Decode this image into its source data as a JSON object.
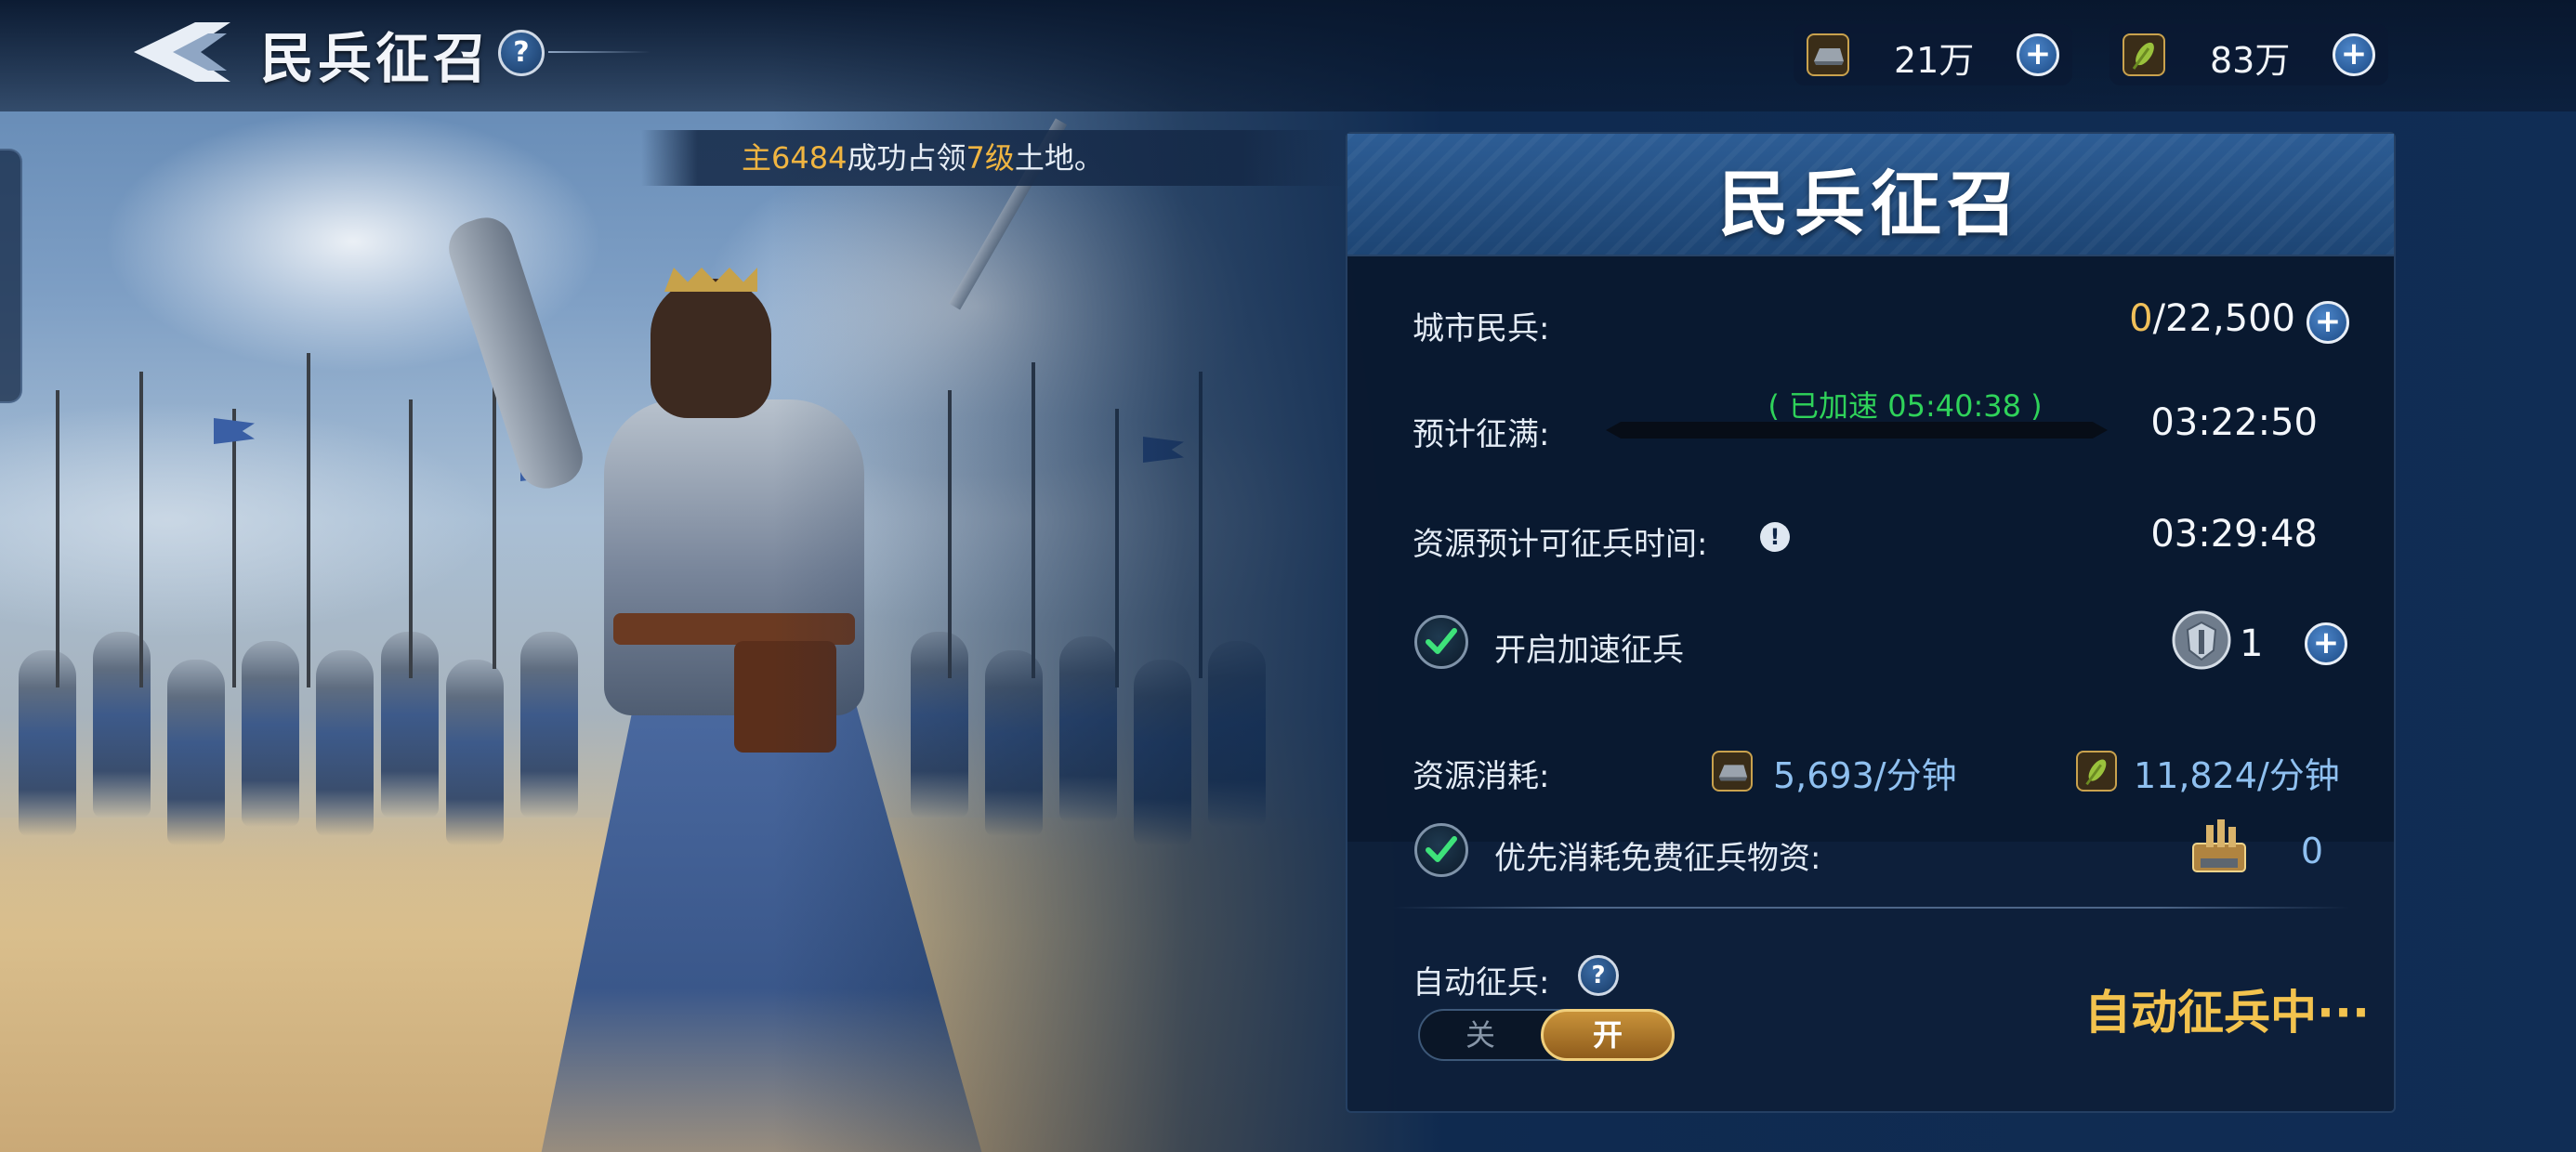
{
  "header": {
    "title": "民兵征召"
  },
  "resources": [
    {
      "icon": "iron-ingot-icon",
      "amount": "21万"
    },
    {
      "icon": "wheat-icon",
      "amount": "83万"
    }
  ],
  "ticker": {
    "prefix": "主",
    "player_id": "6484",
    "mid": "成功占领",
    "level": "7级",
    "suffix": "土地。"
  },
  "panel": {
    "title": "民兵征召",
    "city_militia": {
      "label": "城市民兵:",
      "current": "0",
      "max": "/22,500"
    },
    "eta": {
      "label": "预计征满:",
      "accelerated_note": "( 已加速 05:40:38 )",
      "time": "03:22:50"
    },
    "resource_time": {
      "label": "资源预计可征兵时间:",
      "time": "03:29:48"
    },
    "speed_up": {
      "label": "开启加速征兵",
      "checked": true,
      "item_icon": "helmet-shield-icon",
      "count": "1"
    },
    "consumption": {
      "label": "资源消耗:",
      "iron_rate": "5,693/分钟",
      "food_rate": "11,824/分钟"
    },
    "free_supplies": {
      "label": "优先消耗免费征兵物资:",
      "checked": true,
      "item_icon": "supply-crate-icon",
      "count": "0"
    },
    "auto": {
      "label": "自动征兵:",
      "off_label": "关",
      "on_label": "开",
      "state": "on",
      "status": "自动征兵中···"
    }
  },
  "colors": {
    "accent_gold": "#f0c05a",
    "accel_green": "#2fd35a",
    "value_blue": "#8fc0f0",
    "panel_bg": "#0d1e38"
  }
}
